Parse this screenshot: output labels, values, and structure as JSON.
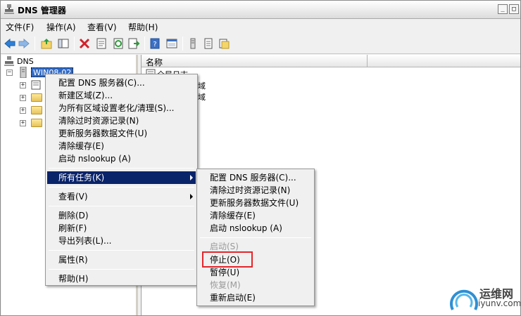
{
  "window": {
    "title": "DNS 管理器",
    "controls": {
      "minimize": "_",
      "restore": "□",
      "close": "×"
    }
  },
  "menubar": [
    {
      "label": "文件(F)"
    },
    {
      "label": "操作(A)"
    },
    {
      "label": "查看(V)"
    },
    {
      "label": "帮助(H)"
    }
  ],
  "toolbar": {
    "icons": [
      "back-arrow-icon",
      "forward-arrow-icon",
      "up-folder-icon",
      "show-hide-tree-icon",
      "delete-icon",
      "properties-icon",
      "refresh-icon",
      "export-list-icon",
      "help-icon",
      "console-icon",
      "server-list-icon",
      "record-icon",
      "folder-icon"
    ]
  },
  "tree": {
    "root": "DNS",
    "server": "WIN08-02"
  },
  "right_pane": {
    "column_name": "名称",
    "rows": [
      "全局日志",
      "域",
      "域"
    ]
  },
  "context_menu": {
    "items": [
      {
        "label": "配置 DNS 服务器(C)..."
      },
      {
        "label": "新建区域(Z)..."
      },
      {
        "label": "为所有区域设置老化/清理(S)..."
      },
      {
        "label": "清除过时资源记录(N)"
      },
      {
        "label": "更新服务器数据文件(U)"
      },
      {
        "label": "清除缓存(E)"
      },
      {
        "label": "启动 nslookup (A)"
      },
      {
        "label": "所有任务(K)"
      },
      {
        "label": "查看(V)"
      },
      {
        "label": "删除(D)"
      },
      {
        "label": "刷新(F)"
      },
      {
        "label": "导出列表(L)..."
      },
      {
        "label": "属性(R)"
      },
      {
        "label": "帮助(H)"
      }
    ]
  },
  "submenu": {
    "items": [
      {
        "label": "配置 DNS 服务器(C)..."
      },
      {
        "label": "清除过时资源记录(N)"
      },
      {
        "label": "更新服务器数据文件(U)"
      },
      {
        "label": "清除缓存(E)"
      },
      {
        "label": "启动 nslookup (A)"
      },
      {
        "label": "启动(S)"
      },
      {
        "label": "停止(O)"
      },
      {
        "label": "暂停(U)"
      },
      {
        "label": "恢复(M)"
      },
      {
        "label": "重新启动(E)"
      }
    ]
  },
  "watermark": {
    "name": "运维网",
    "url": "iyunv.com"
  },
  "colors": {
    "highlight": "#0a246a",
    "selection": "#316ac5",
    "annotation": "#e2262b"
  }
}
